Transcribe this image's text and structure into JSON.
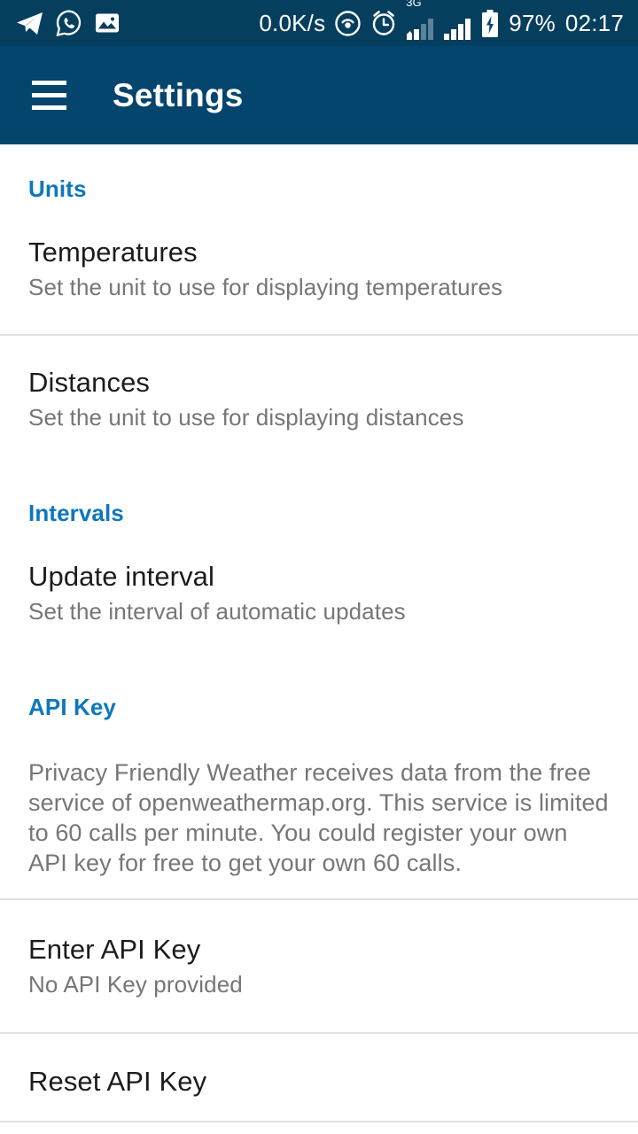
{
  "status_bar": {
    "network_speed": "0.0K/s",
    "battery_percent": "97%",
    "time": "02:17",
    "signal_label": "3G",
    "left_icons": [
      "telegram-icon",
      "whatsapp-icon",
      "gallery-icon"
    ],
    "right_icons": [
      "hotspot-icon",
      "alarm-icon",
      "signal-3g-icon",
      "signal-icon",
      "battery-charging-icon"
    ],
    "background_color": "#063f5e"
  },
  "app_bar": {
    "title": "Settings",
    "menu_icon": "hamburger-menu-icon",
    "background_color": "#04456e",
    "text_color": "#ffffff"
  },
  "theme": {
    "accent_color": "#0d77bd",
    "title_color": "#1c1c1c",
    "summary_color": "#767676",
    "divider_color": "#e2e2e2",
    "background_color": "#ffffff"
  },
  "sections": [
    {
      "header": "Units",
      "items": [
        {
          "title": "Temperatures",
          "summary": "Set the unit to use for displaying temperatures"
        },
        {
          "title": "Distances",
          "summary": "Set the unit to use for displaying distances"
        }
      ]
    },
    {
      "header": "Intervals",
      "items": [
        {
          "title": "Update interval",
          "summary": "Set the interval of automatic updates"
        }
      ]
    },
    {
      "header": "API Key",
      "paragraph": "Privacy Friendly Weather receives data from the free service of openweathermap.org. This service is limited to 60 calls per minute. You could register your own API key for free to get your own 60 calls.",
      "items": [
        {
          "title": "Enter API Key",
          "summary": "No API Key provided"
        },
        {
          "title": "Reset API Key",
          "summary": ""
        }
      ]
    }
  ]
}
